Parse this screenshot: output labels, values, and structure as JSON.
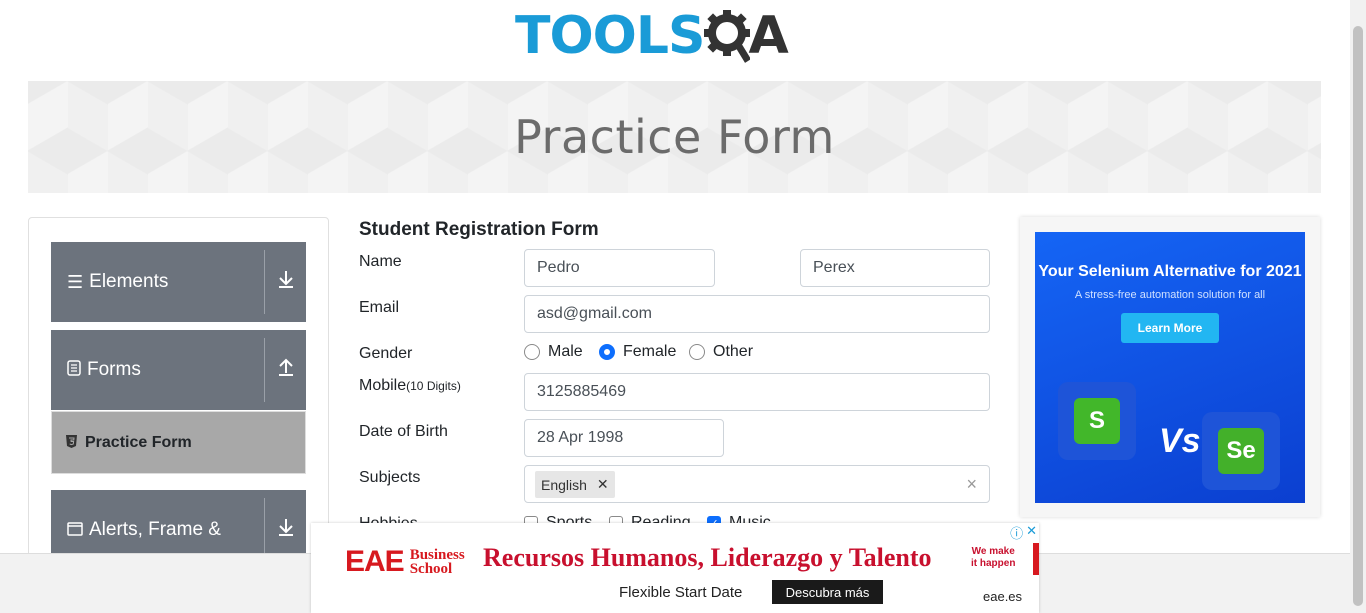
{
  "logo": {
    "part1": "TOOLS",
    "part2": "QA"
  },
  "banner": {
    "title": "Practice Form"
  },
  "sidebar": {
    "groups": [
      {
        "label": "Elements",
        "icon": "hamburger-icon",
        "arrow": "download-icon"
      },
      {
        "label": "Forms",
        "icon": "document-icon",
        "arrow": "upload-icon"
      },
      {
        "label": "Alerts, Frame &",
        "icon": "window-icon",
        "arrow": "download-icon"
      }
    ],
    "active_item": {
      "label": "Practice Form",
      "icon": "html5-icon"
    }
  },
  "form": {
    "title": "Student Registration Form",
    "name_label": "Name",
    "first_name": "Pedro",
    "last_name": "Perex",
    "email_label": "Email",
    "email": "asd@gmail.com",
    "gender_label": "Gender",
    "gender_options": [
      "Male",
      "Female",
      "Other"
    ],
    "gender_selected": "Female",
    "mobile_label": "Mobile",
    "mobile_hint": "(10 Digits)",
    "mobile": "3125885469",
    "dob_label": "Date of Birth",
    "dob": "28 Apr 1998",
    "subjects_label": "Subjects",
    "subjects": [
      "English"
    ],
    "hobbies_label": "Hobbies",
    "hobbies": [
      {
        "label": "Sports",
        "checked": false
      },
      {
        "label": "Reading",
        "checked": false
      },
      {
        "label": "Music",
        "checked": true
      }
    ]
  },
  "ad_right": {
    "headline": "Your Selenium Alternative for 2021",
    "subline": "A stress-free automation solution for all",
    "cta": "Learn More",
    "vs_text": "Vs",
    "left_logo": "S",
    "right_logo": "Se"
  },
  "ad_bottom": {
    "brand": "EAE",
    "brand_sub1": "Business",
    "brand_sub2": "School",
    "headline": "Recursos Humanos, Liderazgo y Talento",
    "tag1": "We make",
    "tag2": "it happen",
    "subtext": "Flexible Start Date",
    "cta": "Descubra más",
    "domain": "eae.es"
  },
  "colors": {
    "accent": "#0d6efd",
    "sidebar_group": "#6c737d",
    "logo_blue": "#1a9bd7",
    "ad_red": "#d7191f"
  }
}
